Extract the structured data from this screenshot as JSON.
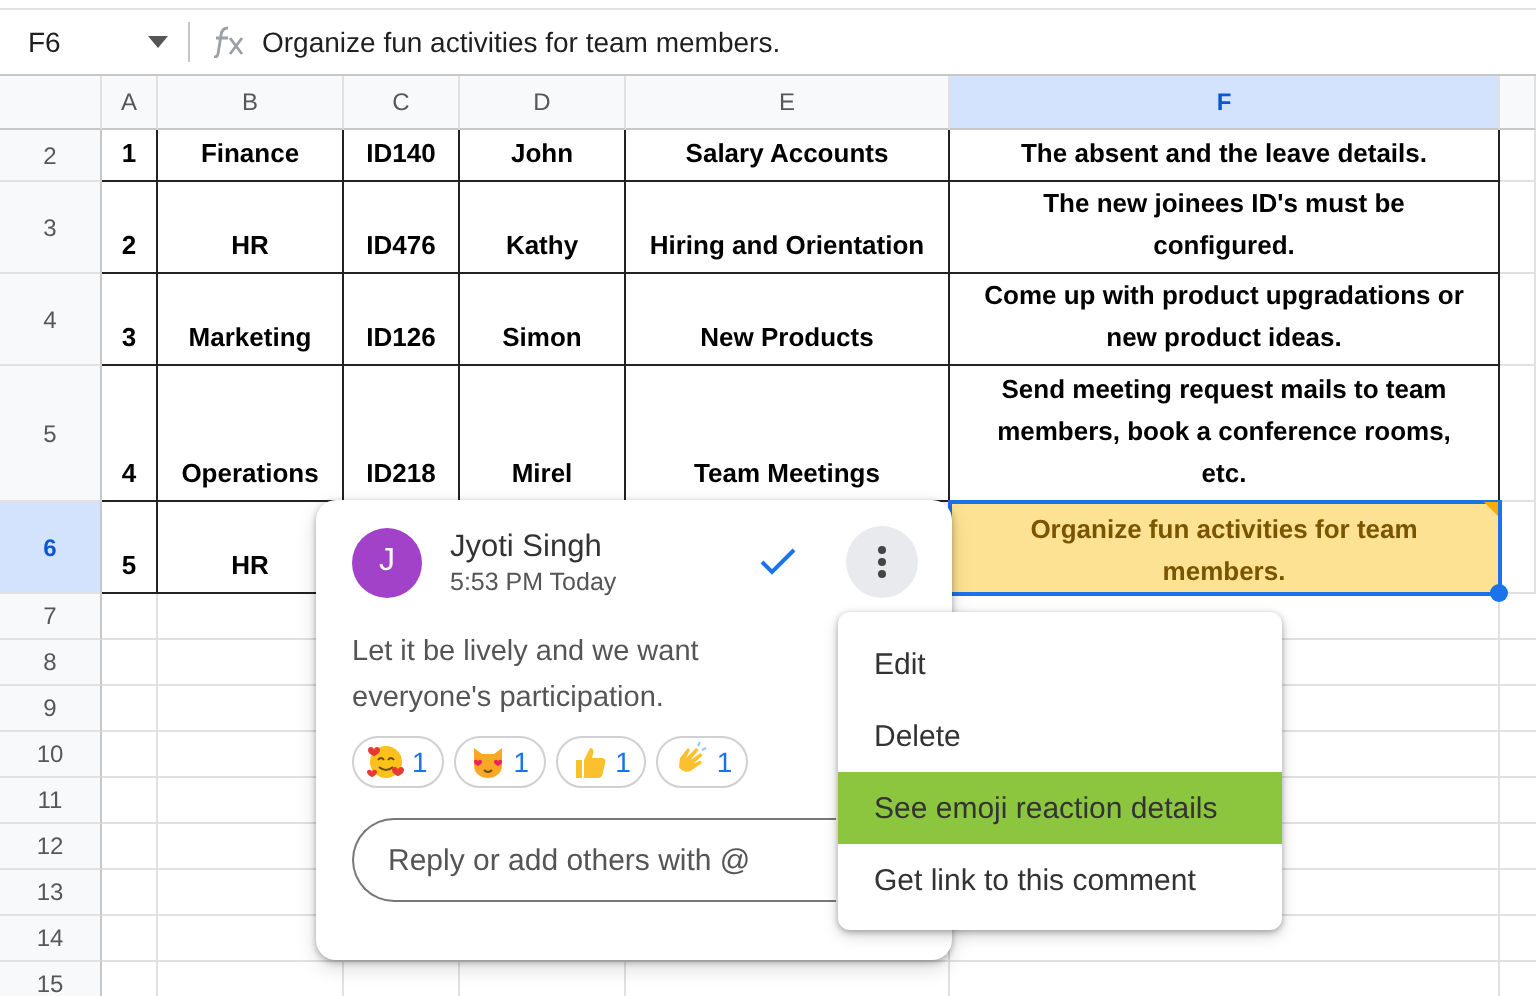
{
  "formula_bar": {
    "name_box": "F6",
    "formula": "Organize fun activities for team members."
  },
  "columns": [
    {
      "label": "A",
      "selected": false
    },
    {
      "label": "B",
      "selected": false
    },
    {
      "label": "C",
      "selected": false
    },
    {
      "label": "D",
      "selected": false
    },
    {
      "label": "E",
      "selected": false
    },
    {
      "label": "F",
      "selected": true
    }
  ],
  "rows": [
    {
      "number": "2",
      "selected": false,
      "cells": [
        "1",
        "Finance",
        "ID140",
        "John",
        "Salary Accounts",
        "The absent and the leave details."
      ]
    },
    {
      "number": "3",
      "selected": false,
      "cells": [
        "2",
        "HR",
        "ID476",
        "Kathy",
        "Hiring and Orientation",
        "The new joinees ID's must be configured."
      ]
    },
    {
      "number": "4",
      "selected": false,
      "cells": [
        "3",
        "Marketing",
        "ID126",
        "Simon",
        "New Products",
        "Come up with product upgradations or new product ideas."
      ]
    },
    {
      "number": "5",
      "selected": false,
      "cells": [
        "4",
        "Operations",
        "ID218",
        "Mirel",
        "Team Meetings",
        "Send meeting request mails to team members, book a conference rooms, etc."
      ]
    },
    {
      "number": "6",
      "selected": true,
      "cells": [
        "5",
        "HR",
        null,
        null,
        null,
        "Organize fun activities for team members."
      ]
    },
    {
      "number": "7",
      "selected": false
    },
    {
      "number": "8",
      "selected": false
    },
    {
      "number": "9",
      "selected": false
    },
    {
      "number": "10",
      "selected": false
    },
    {
      "number": "11",
      "selected": false
    },
    {
      "number": "12",
      "selected": false
    },
    {
      "number": "13",
      "selected": false
    },
    {
      "number": "14",
      "selected": false
    },
    {
      "number": "15",
      "selected": false
    }
  ],
  "comment": {
    "avatar": "J",
    "author": "Jyoti Singh",
    "time": "5:53 PM Today",
    "text": "Let it be lively and we want everyone's participation.",
    "reactions": [
      {
        "kind": "hearts-face",
        "count": "1"
      },
      {
        "kind": "cat-face",
        "count": "1"
      },
      {
        "kind": "thumbs-up",
        "count": "1"
      },
      {
        "kind": "clap",
        "count": "1"
      }
    ],
    "reply": {
      "placeholder": "Reply or add others with @"
    }
  },
  "menu": [
    {
      "label": "Edit",
      "selected": false
    },
    {
      "label": "Delete",
      "selected": false
    },
    {
      "label": "See emoji reaction details",
      "selected": true
    },
    {
      "label": "Get link to this comment",
      "selected": false
    }
  ]
}
